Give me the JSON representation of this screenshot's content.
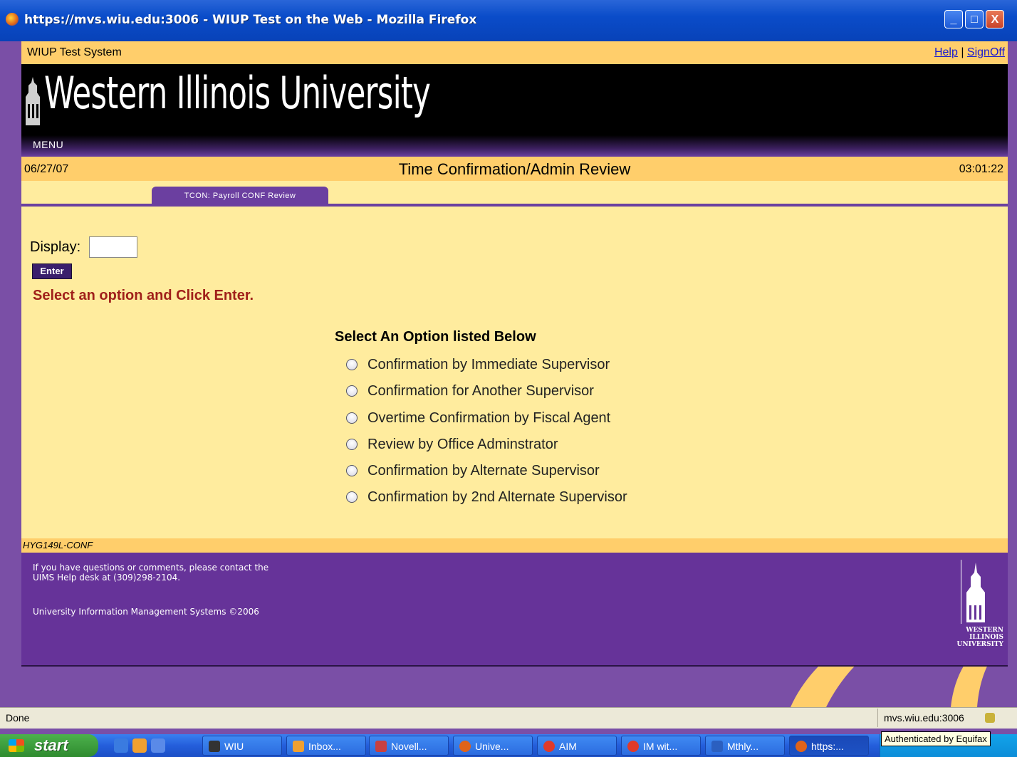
{
  "window": {
    "title": "https://mvs.wiu.edu:3006 - WIUP Test on the Web - Mozilla Firefox",
    "minimize": "_",
    "maximize": "□",
    "close": "X"
  },
  "page": {
    "system_name": "WIUP Test System",
    "help_link": "Help",
    "separator": " | ",
    "signoff_link": "SignOff",
    "banner_wordmark": "Western Illinois University",
    "menu_label": "MENU",
    "date": "06/27/07",
    "screen_title": "Time Confirmation/Admin Review",
    "time": "03:01:22",
    "tab_label": "TCON: Payroll CONF Review",
    "display_label": "Display:",
    "display_value": "",
    "enter_button": "Enter",
    "instruction": "Select an option and Click Enter.",
    "options_heading": "Select An Option listed Below",
    "options": [
      "Confirmation by Immediate Supervisor",
      "Confirmation for Another Supervisor",
      "Overtime Confirmation by Fiscal Agent",
      "Review by Office Adminstrator",
      "Confirmation by Alternate Supervisor",
      "Confirmation by 2nd Alternate Supervisor"
    ],
    "screen_code": "HYG149L-CONF",
    "footer_line1": "If you have questions or comments, please contact the",
    "footer_line2": "UIMS Help desk at (309)298-2104.",
    "footer_line3": "University Information Management Systems ©2006",
    "logo_lines": [
      "WESTERN",
      "ILLINOIS",
      "UNIVERSITY"
    ]
  },
  "statusbar": {
    "status": "Done",
    "host": "mvs.wiu.edu:3006",
    "tooltip": "Authenticated by Equifax"
  },
  "taskbar": {
    "start": "start",
    "buttons": [
      "WIU",
      "Inbox...",
      "Novell...",
      "Unive...",
      "AIM",
      "IM wit...",
      "Mthly...",
      "https:..."
    ]
  },
  "colors": {
    "gold": "#ffce6b",
    "cream": "#ffec9e",
    "purple": "#663399",
    "error_red": "#a0201a"
  }
}
